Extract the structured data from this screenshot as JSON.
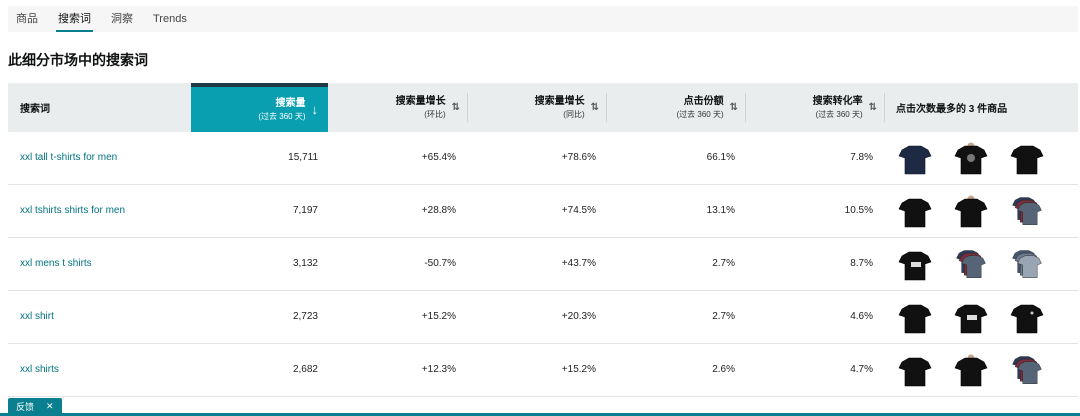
{
  "tabs": [
    "商品",
    "搜索词",
    "洞察",
    "Trends"
  ],
  "active_tab": 1,
  "section_title": "此细分市场中的搜索词",
  "columns": {
    "term": "搜索词",
    "volume": {
      "label": "搜索量",
      "sub": "(过去 360 天)"
    },
    "growth_mom": {
      "label": "搜索量增长",
      "sub": "(环比)"
    },
    "growth_yoy": {
      "label": "搜索量增长",
      "sub": "(同比)"
    },
    "click_share": {
      "label": "点击份额",
      "sub": "(过去 360 天)"
    },
    "conversion": {
      "label": "搜索转化率",
      "sub": "(过去 360 天)"
    },
    "top_products": "点击次数最多的 3 件商品"
  },
  "rows": [
    {
      "term": "xxl tall t-shirts for men",
      "volume": "15,711",
      "growth_mom": "+65.4%",
      "growth_yoy": "+78.6%",
      "click_share": "66.1%",
      "conversion": "7.8%",
      "products": [
        "navy-tshirt",
        "black-graphic-tshirt",
        "black-tshirt"
      ]
    },
    {
      "term": "xxl tshirts shirts for men",
      "volume": "7,197",
      "growth_mom": "+28.8%",
      "growth_yoy": "+74.5%",
      "click_share": "13.1%",
      "conversion": "10.5%",
      "products": [
        "black-tshirt",
        "black-tshirt-model",
        "multipack-tshirts"
      ]
    },
    {
      "term": "xxl mens t shirts",
      "volume": "3,132",
      "growth_mom": "-50.7%",
      "growth_yoy": "+43.7%",
      "click_share": "2.7%",
      "conversion": "8.7%",
      "products": [
        "black-print-tshirt",
        "multipack-tshirts",
        "multipack-tshirts-gray"
      ]
    },
    {
      "term": "xxl shirt",
      "volume": "2,723",
      "growth_mom": "+15.2%",
      "growth_yoy": "+20.3%",
      "click_share": "2.7%",
      "conversion": "4.6%",
      "products": [
        "black-tshirt",
        "black-print-tshirt",
        "black-tshirt-logo"
      ]
    },
    {
      "term": "xxl shirts",
      "volume": "2,682",
      "growth_mom": "+12.3%",
      "growth_yoy": "+15.2%",
      "click_share": "2.6%",
      "conversion": "4.7%",
      "products": [
        "black-tshirt",
        "black-tshirt-model",
        "multipack-tshirts"
      ]
    }
  ],
  "feedback": {
    "label": "反馈",
    "close": "✕"
  },
  "colors": {
    "accent": "#0a9fb0",
    "link": "#00727f",
    "header_bg": "#e9eded",
    "sort_top": "#1f3a44"
  }
}
